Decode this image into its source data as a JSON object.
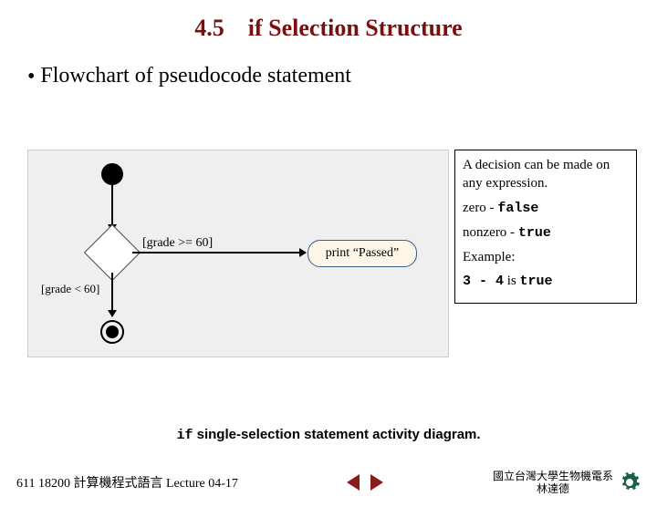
{
  "heading": {
    "section_no": "4.5",
    "text": "if Selection Structure"
  },
  "bullet_text": "Flowchart of pseudocode statement",
  "diagram": {
    "guard_true": "[grade >= 60]",
    "guard_false": "[grade < 60]",
    "action_label": "print “Passed”"
  },
  "sidepanel": {
    "line1": "A decision can be made on any expression.",
    "zero_label": "zero - ",
    "zero_val": "false",
    "nonzero_label": "nonzero - ",
    "nonzero_val": "true",
    "example_label": "Example:",
    "example_expr": "3 - 4",
    "example_mid": " is ",
    "example_val": "true"
  },
  "caption": {
    "kw": "if",
    "rest": " single-selection statement activity diagram."
  },
  "footer": {
    "course": "611 18200 計算機程式語言  Lecture 04-17",
    "org_line1": "國立台灣大學生物機電系",
    "org_line2": "林達德"
  }
}
